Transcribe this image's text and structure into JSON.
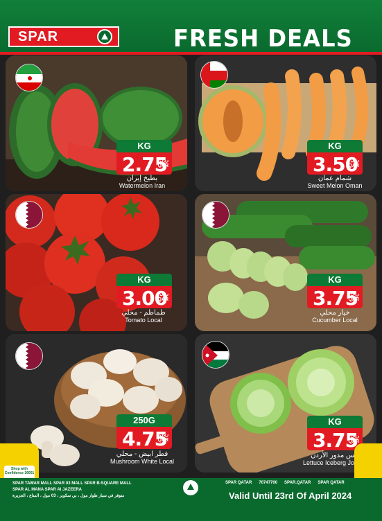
{
  "header": {
    "brand": "SPAR",
    "title": "FRESH DEALS"
  },
  "products": [
    {
      "name_en": "Watermelon Iran",
      "name_ar": "بطيخ إيران",
      "unit": "KG",
      "price": "2.75",
      "currency_ar": "ريال",
      "currency_en": "QAR",
      "flag": "iran-flag",
      "colors": {
        "bg": "#4a3a2c"
      }
    },
    {
      "name_en": "Sweet Melon Oman",
      "name_ar": "شمام عمان",
      "unit": "KG",
      "price": "3.50",
      "currency_ar": "ريال",
      "currency_en": "QAR",
      "flag": "oman-flag",
      "colors": {
        "bg": "#2e2e2e"
      }
    },
    {
      "name_en": "Tomato Local",
      "name_ar": "طماطم - محلي",
      "unit": "KG",
      "price": "3.00",
      "currency_ar": "ريال",
      "currency_en": "QAR",
      "flag": "qatar-flag",
      "colors": {
        "bg": "#3a2a22"
      }
    },
    {
      "name_en": "Cucumber Local",
      "name_ar": "خيار محلي",
      "unit": "KG",
      "price": "3.75",
      "currency_ar": "ريال",
      "currency_en": "QAR",
      "flag": "qatar-flag",
      "colors": {
        "bg": "#5a4a3a"
      }
    },
    {
      "name_en": "Mushroom White Local",
      "name_ar": "فطر ابيض - محلي",
      "unit": "250G",
      "price": "4.75",
      "currency_ar": "ريال",
      "currency_en": "QAR",
      "flag": "qatar-flag",
      "colors": {
        "bg": "#2a2a2a"
      }
    },
    {
      "name_en": "Lettuce Iceberg Jordan",
      "name_ar": "خس مدور الأردن",
      "unit": "KG",
      "price": "3.75",
      "currency_ar": "ريال",
      "currency_en": "QAR",
      "flag": "jordan-flag",
      "colors": {
        "bg": "#333333"
      }
    }
  ],
  "footer": {
    "stores_line1": "SPAR TAWAR MALL   SPAR 03 MALL   SPAR B-SQUARE MALL",
    "stores_line2": "SPAR AL MANA   SPAR Al JAZEERA",
    "stores_ar": "متوفر في سبار طوار مول ، بي سكوير ، 03 مول ، المناع ، الجزيرة",
    "social_1": "SPAR QATAR",
    "social_2": "70747700",
    "social_3": "SPAR.QATAR",
    "social_4": "SPAR QATAR",
    "valid": "Valid Until 23rd Of April 2024",
    "badge": "Shop with Confidence 16001"
  },
  "colors": {
    "green": "#0a6a2e",
    "red": "#e21b23",
    "yellow": "#f5d100"
  }
}
